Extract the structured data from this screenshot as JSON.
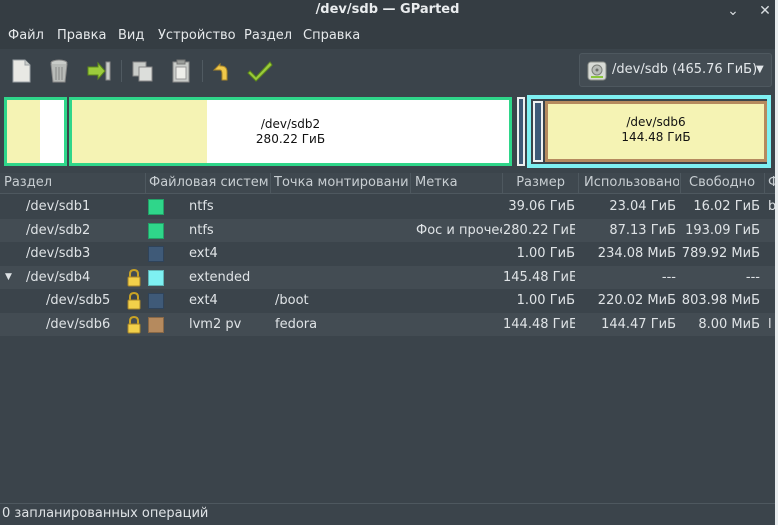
{
  "window": {
    "title": "/dev/sdb — GParted",
    "minimize_glyph": "⌄",
    "close_glyph": "✕"
  },
  "menu": [
    "Файл",
    "Правка",
    "Вид",
    "Устройство",
    "Раздел",
    "Справка"
  ],
  "toolbar": {
    "icons": [
      "new-partition-icon",
      "delete-partition-icon",
      "resize-move-icon",
      "copy-icon",
      "paste-icon",
      "undo-icon",
      "apply-icon"
    ]
  },
  "device": {
    "label": "/dev/sdb   (465.76 ГиБ)",
    "icon": "harddisk-icon"
  },
  "diskmap": {
    "sdb2": {
      "name": "/dev/sdb2",
      "size": "280.22 ГиБ",
      "used_fraction": 0.31
    },
    "sdb6": {
      "name": "/dev/sdb6",
      "size": "144.48 ГиБ",
      "used_fraction": 0.999
    }
  },
  "columns": [
    "Раздел",
    "Файловая система",
    "Точка монтирования",
    "Метка",
    "Размер",
    "Использовано",
    "Свободно",
    "Ф"
  ],
  "rows": [
    {
      "partition": "/dev/sdb1",
      "fs": "ntfs",
      "mount": "",
      "label": "",
      "size": "39.06 ГиБ",
      "used": "23.04 ГиБ",
      "free": "16.02 ГиБ",
      "flags": "b",
      "fs_color": "#2fd68a",
      "locked": false,
      "level": 0,
      "expander": ""
    },
    {
      "partition": "/dev/sdb2",
      "fs": "ntfs",
      "mount": "",
      "label": "Фос и прочее",
      "size": "280.22 ГиБ",
      "used": "87.13 ГиБ",
      "free": "193.09 ГиБ",
      "flags": "",
      "fs_color": "#2fd68a",
      "locked": false,
      "level": 0,
      "expander": ""
    },
    {
      "partition": "/dev/sdb3",
      "fs": "ext4",
      "mount": "",
      "label": "",
      "size": "1.00 ГиБ",
      "used": "234.08 МиБ",
      "free": "789.92 МиБ",
      "flags": "",
      "fs_color": "#3f5a78",
      "locked": false,
      "level": 0,
      "expander": ""
    },
    {
      "partition": "/dev/sdb4",
      "fs": "extended",
      "mount": "",
      "label": "",
      "size": "145.48 ГиБ",
      "used": "---",
      "free": "---",
      "flags": "",
      "fs_color": "#7ef0f2",
      "locked": true,
      "level": 0,
      "expander": "▼"
    },
    {
      "partition": "/dev/sdb5",
      "fs": "ext4",
      "mount": "/boot",
      "label": "",
      "size": "1.00 ГиБ",
      "used": "220.02 МиБ",
      "free": "803.98 МиБ",
      "flags": "",
      "fs_color": "#3f5a78",
      "locked": true,
      "level": 1,
      "expander": ""
    },
    {
      "partition": "/dev/sdb6",
      "fs": "lvm2 pv",
      "mount": "fedora",
      "label": "",
      "size": "144.48 ГиБ",
      "used": "144.47 ГиБ",
      "free": "8.00 МиБ",
      "flags": "l",
      "fs_color": "#b58a5e",
      "locked": true,
      "level": 1,
      "expander": ""
    }
  ],
  "status": "0 запланированных операций",
  "colors": {
    "ntfs": "#2fd68a",
    "ext4": "#3f5a78",
    "extended": "#7ef0f2",
    "lvm2": "#b58a5e",
    "used": "#f5f3b4",
    "unused": "#ffffff"
  }
}
